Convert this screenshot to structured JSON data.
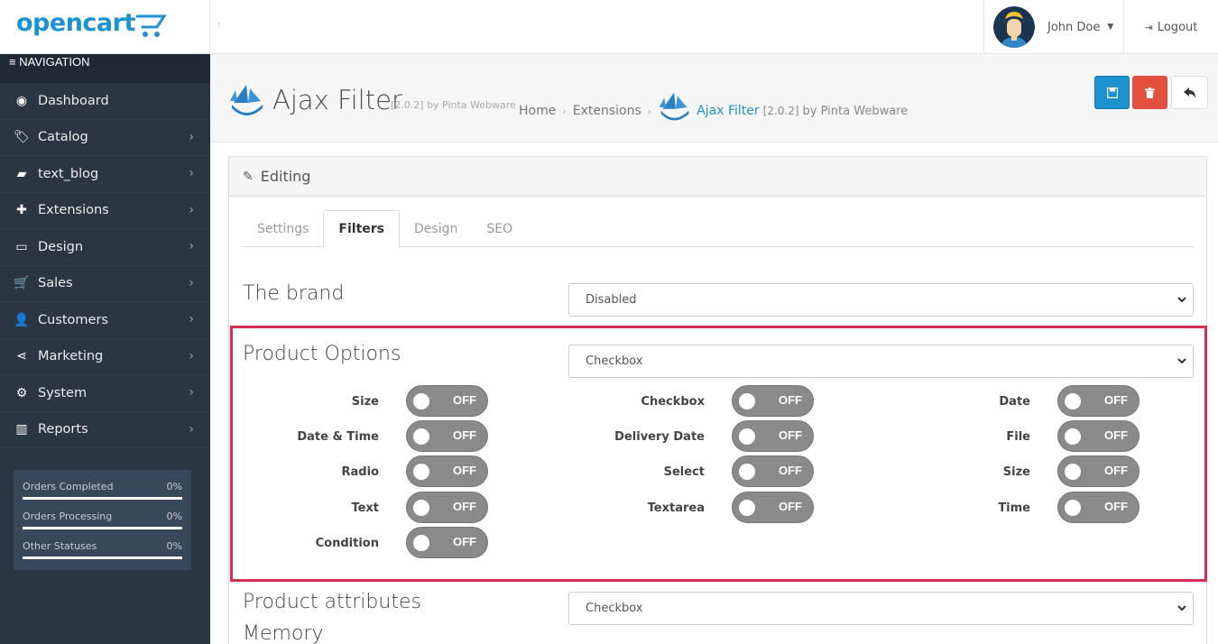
{
  "header": {
    "logo_text": "opencart",
    "dot": "·",
    "user_name": "John Doe",
    "logout_label": "Logout"
  },
  "sidebar": {
    "nav_heading": "NAVIGATION",
    "items": [
      {
        "label": "Dashboard",
        "icon": "dashboard-icon",
        "glyph": "◉",
        "has_arrow": false
      },
      {
        "label": "Catalog",
        "icon": "tags-icon",
        "glyph": "🏷",
        "has_arrow": true
      },
      {
        "label": "text_blog",
        "icon": "book-icon",
        "glyph": "▰",
        "has_arrow": true
      },
      {
        "label": "Extensions",
        "icon": "puzzle-icon",
        "glyph": "✚",
        "has_arrow": true
      },
      {
        "label": "Design",
        "icon": "monitor-icon",
        "glyph": "▭",
        "has_arrow": true
      },
      {
        "label": "Sales",
        "icon": "cart-icon",
        "glyph": "🛒",
        "has_arrow": true
      },
      {
        "label": "Customers",
        "icon": "user-icon",
        "glyph": "👤",
        "has_arrow": true
      },
      {
        "label": "Marketing",
        "icon": "share-icon",
        "glyph": "⋖",
        "has_arrow": true
      },
      {
        "label": "System",
        "icon": "cog-icon",
        "glyph": "⚙",
        "has_arrow": true
      },
      {
        "label": "Reports",
        "icon": "bar-chart-icon",
        "glyph": "▥",
        "has_arrow": true
      }
    ],
    "stats": [
      {
        "label": "Orders Completed",
        "value": "0%"
      },
      {
        "label": "Orders Processing",
        "value": "0%"
      },
      {
        "label": "Other Statuses",
        "value": "0%"
      }
    ]
  },
  "page_header": {
    "title": "Ajax Filter",
    "version_suffix": "[2.0.2] by Pinta Webware",
    "breadcrumbs": {
      "home": "Home",
      "extensions": "Extensions",
      "active": "Ajax Filter",
      "active_version": "[2.0.2]",
      "active_by": "by Pinta Webware"
    }
  },
  "colors": {
    "primary": "#1e91cf",
    "danger": "#e3503e",
    "sidebar_bg": "#2b3643",
    "highlight": "#d32f54"
  },
  "panel": {
    "heading": "Editing",
    "tabs": [
      {
        "label": "Settings",
        "active": false
      },
      {
        "label": "Filters",
        "active": true
      },
      {
        "label": "Design",
        "active": false
      },
      {
        "label": "SEO",
        "active": false
      }
    ],
    "brand": {
      "title": "The brand",
      "value": "Disabled"
    },
    "product_options": {
      "title": "Product Options",
      "value": "Checkbox",
      "options": [
        {
          "label": "Size",
          "state": "OFF"
        },
        {
          "label": "Checkbox",
          "state": "OFF"
        },
        {
          "label": "Date",
          "state": "OFF"
        },
        {
          "label": "Date & Time",
          "state": "OFF"
        },
        {
          "label": "Delivery Date",
          "state": "OFF"
        },
        {
          "label": "File",
          "state": "OFF"
        },
        {
          "label": "Radio",
          "state": "OFF"
        },
        {
          "label": "Select",
          "state": "OFF"
        },
        {
          "label": "Size",
          "state": "OFF"
        },
        {
          "label": "Text",
          "state": "OFF"
        },
        {
          "label": "Textarea",
          "state": "OFF"
        },
        {
          "label": "Time",
          "state": "OFF"
        },
        {
          "label": "Condition",
          "state": "OFF"
        }
      ]
    },
    "product_attributes": {
      "title": "Product attributes",
      "value": "Checkbox"
    },
    "memory_title": "Memory"
  }
}
